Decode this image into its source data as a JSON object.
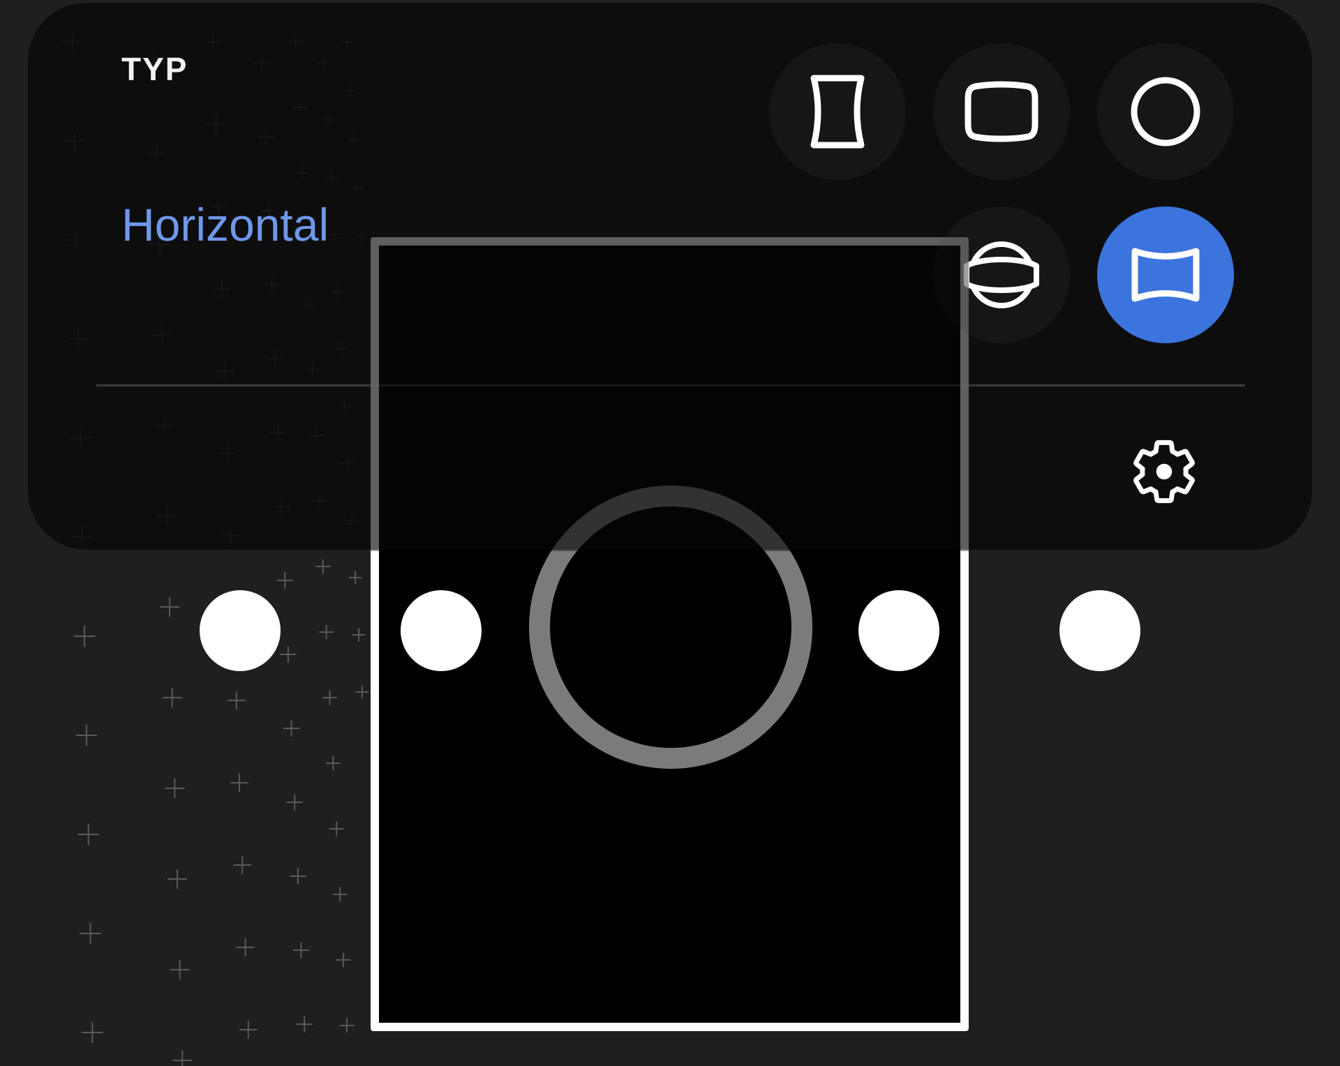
{
  "panel": {
    "title": "TYP",
    "selected_mode_label": "Horizontal"
  },
  "modes": [
    {
      "name": "vertical",
      "icon": "vertical-panorama-icon",
      "selected": false
    },
    {
      "name": "wide-angle",
      "icon": "wide-angle-icon",
      "selected": false
    },
    {
      "name": "fisheye",
      "icon": "fisheye-circle-icon",
      "selected": false
    },
    {
      "name": "photo-sphere",
      "icon": "photo-sphere-icon",
      "selected": false
    },
    {
      "name": "horizontal",
      "icon": "horizontal-panorama-icon",
      "selected": true
    }
  ],
  "settings": {
    "icon": "gear-icon"
  },
  "capture": {
    "guide_dots": 4,
    "shutter": "shutter-ring"
  },
  "colors": {
    "accent": "#3c74dd",
    "label_accent": "#6f98ea",
    "panel_bg": "#0a0a0a",
    "background": "#1f1f1f",
    "shutter_ring": "#7b7b7b"
  }
}
